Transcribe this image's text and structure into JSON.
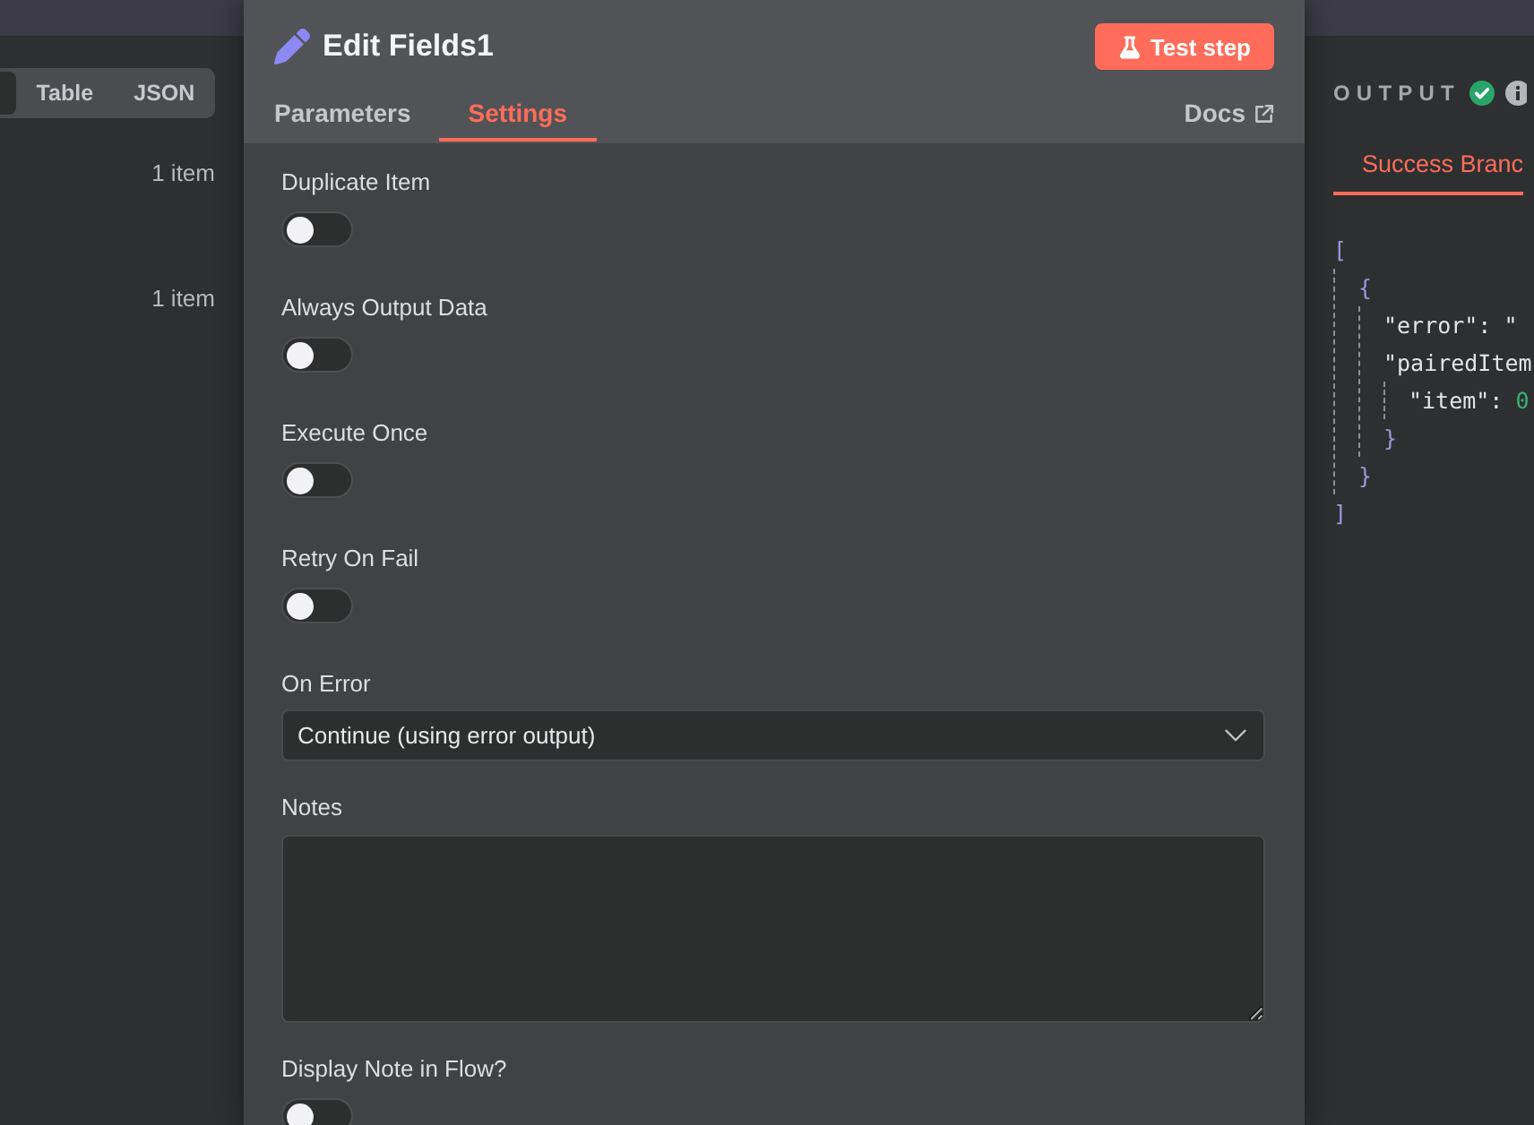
{
  "input_panel": {
    "view_tabs": [
      {
        "selected": true
      },
      {
        "label": "Table",
        "selected": false
      },
      {
        "label": "JSON",
        "selected": false
      }
    ],
    "item_counts": [
      "1 item",
      "1 item"
    ]
  },
  "node_panel": {
    "title": "Edit Fields1",
    "test_button": "Test step",
    "tabs": [
      {
        "label": "Parameters",
        "selected": false
      },
      {
        "label": "Settings",
        "selected": true
      }
    ],
    "docs_link": "Docs",
    "settings": [
      {
        "kind": "toggle",
        "label": "Duplicate Item",
        "on": false
      },
      {
        "kind": "toggle",
        "label": "Always Output Data",
        "on": false
      },
      {
        "kind": "toggle",
        "label": "Execute Once",
        "on": false
      },
      {
        "kind": "toggle",
        "label": "Retry On Fail",
        "on": false
      },
      {
        "kind": "select",
        "label": "On Error",
        "value": "Continue (using error output)"
      },
      {
        "kind": "textarea",
        "label": "Notes"
      },
      {
        "kind": "toggle",
        "label": "Display Note in Flow?",
        "on": false
      }
    ]
  },
  "output_panel": {
    "title": "OUTPUT",
    "branch_tabs": [
      {
        "label": "Success Branc",
        "selected": true
      }
    ],
    "json": {
      "open": "[",
      "children": [
        {
          "open": "{",
          "children": [
            {
              "key": "\"error\":",
              "value": "\"",
              "kind": "string"
            },
            {
              "key": "\"pairedItem",
              "children": [
                {
                  "key": "\"item\":",
                  "value": "0",
                  "kind": "number"
                }
              ],
              "close": "}"
            }
          ],
          "close": "}"
        }
      ],
      "close": "]"
    }
  }
}
